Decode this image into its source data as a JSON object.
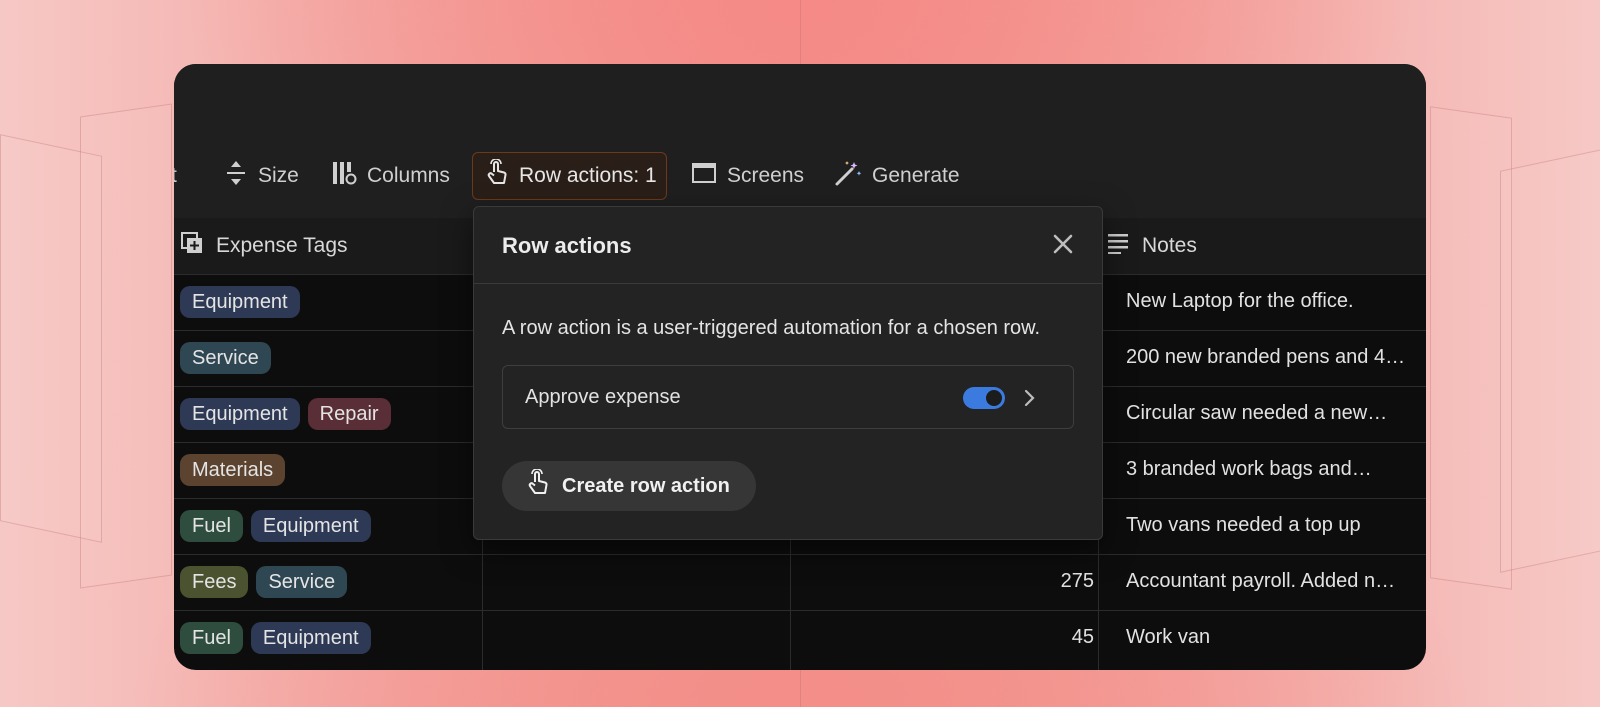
{
  "toolbar": {
    "sort_partial": "rt",
    "size": "Size",
    "columns": "Columns",
    "row_actions": "Row actions: 1",
    "screens": "Screens",
    "generate": "Generate",
    "icons": [
      "sort-icon",
      "resize-vertical-icon",
      "columns-icon",
      "pointer-hand-icon",
      "window-icon",
      "magic-wand-icon"
    ]
  },
  "table": {
    "headers": {
      "expense_tags": "Expense Tags",
      "notes": "Notes"
    },
    "rows": [
      {
        "tags": [
          {
            "label": "Equipment",
            "color": "#2e3a55"
          }
        ],
        "amount": "",
        "note": "New Laptop for the office."
      },
      {
        "tags": [
          {
            "label": "Service",
            "color": "#2f4753"
          }
        ],
        "amount": "",
        "note": "200 new branded pens and 4…"
      },
      {
        "tags": [
          {
            "label": "Equipment",
            "color": "#2e3a55"
          },
          {
            "label": "Repair",
            "color": "#5a2e37"
          }
        ],
        "amount": "",
        "note": "Circular saw needed a new…"
      },
      {
        "tags": [
          {
            "label": "Materials",
            "color": "#5b4330"
          }
        ],
        "amount": "",
        "note": "3 branded work bags and…"
      },
      {
        "tags": [
          {
            "label": "Fuel",
            "color": "#2f4d3f"
          },
          {
            "label": "Equipment",
            "color": "#2e3a55"
          }
        ],
        "amount": "",
        "note": "Two vans needed a top up"
      },
      {
        "tags": [
          {
            "label": "Fees",
            "color": "#4a5230"
          },
          {
            "label": "Service",
            "color": "#2f4753"
          }
        ],
        "amount": "275",
        "note": "Accountant payroll. Added n…"
      },
      {
        "tags": [
          {
            "label": "Fuel",
            "color": "#2f4d3f"
          },
          {
            "label": "Equipment",
            "color": "#2e3a55"
          }
        ],
        "amount": "45",
        "note": "Work van"
      }
    ]
  },
  "popover": {
    "title": "Row actions",
    "description": "A row action is a user-triggered automation for a chosen row.",
    "actions": [
      {
        "label": "Approve expense",
        "enabled": true
      }
    ],
    "create_button": "Create row action"
  },
  "colors": {
    "accent_toggle": "#3b7be0",
    "active_border": "#6b3a1c"
  }
}
